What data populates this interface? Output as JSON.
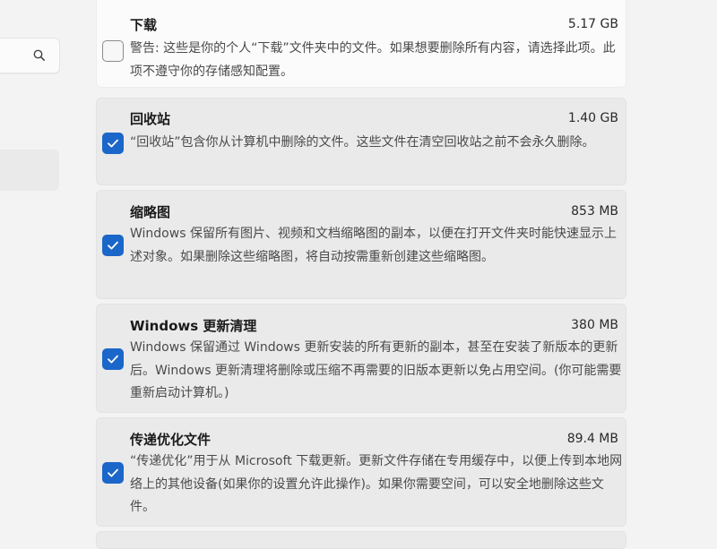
{
  "items": [
    {
      "title": "下载",
      "size": "5.17 GB",
      "checked": false,
      "description": "警告: 这些是你的个人“下载”文件夹中的文件。如果想要删除所有内容，请选择此项。此项不遵守你的存储感知配置。"
    },
    {
      "title": "回收站",
      "size": "1.40 GB",
      "checked": true,
      "description": "“回收站”包含你从计算机中删除的文件。这些文件在清空回收站之前不会永久删除。"
    },
    {
      "title": "缩略图",
      "size": "853 MB",
      "checked": true,
      "description": "Windows 保留所有图片、视频和文档缩略图的副本，以便在打开文件夹时能快速显示上述对象。如果删除这些缩略图，将自动按需重新创建这些缩略图。"
    },
    {
      "title": "Windows 更新清理",
      "size": "380 MB",
      "checked": true,
      "description": "Windows 保留通过 Windows 更新安装的所有更新的副本，甚至在安装了新版本的更新后。Windows 更新清理将删除或压缩不再需要的旧版本更新以免占用空间。(你可能需要重新启动计算机。)"
    },
    {
      "title": "传递优化文件",
      "size": "89.4 MB",
      "checked": true,
      "description": "“传递优化”用于从 Microsoft 下载更新。更新文件存储在专用缓存中，以便上传到本地网络上的其他设备(如果你的设置允许此操作)。如果你需要空间，可以安全地删除这些文件。"
    }
  ],
  "icons": {
    "search": "search-icon",
    "check": "checkmark-icon"
  },
  "colors": {
    "accent": "#1b66c9",
    "background": "#f3f3f3",
    "card": "#fbfbfb"
  }
}
